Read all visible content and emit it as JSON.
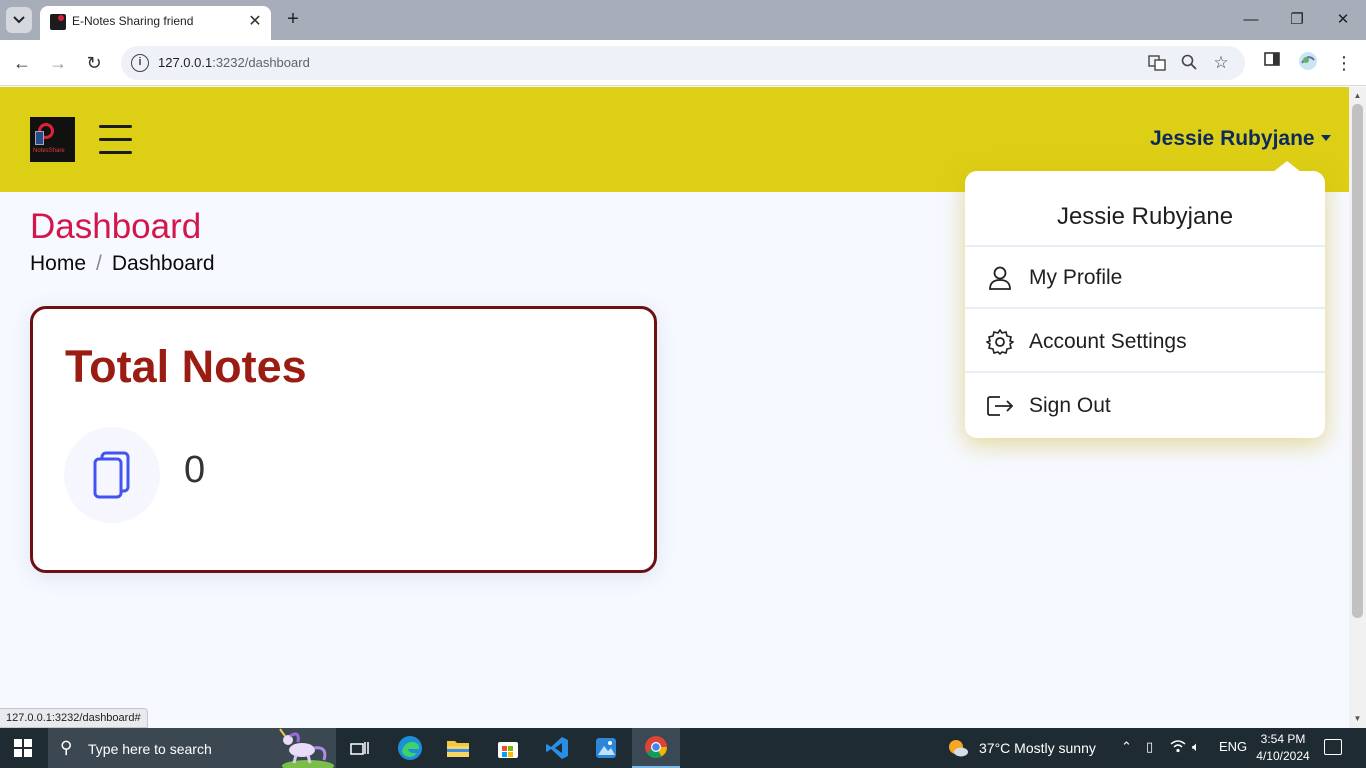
{
  "browser": {
    "tab_title": "E-Notes Sharing friend",
    "url_host": "127.0.0.1",
    "url_path": ":3232/dashboard",
    "status_url": "127.0.0.1:3232/dashboard#"
  },
  "app": {
    "user_name": "Jessie Rubyjane",
    "logo_text": "NotesShare",
    "page_title": "Dashboard",
    "breadcrumb": [
      "Home",
      "Dashboard"
    ]
  },
  "card": {
    "title": "Total Notes",
    "value": "0"
  },
  "dropdown": {
    "header": "Jessie Rubyjane",
    "items": [
      {
        "label": "My Profile",
        "icon": "person-icon"
      },
      {
        "label": "Account Settings",
        "icon": "gear-icon"
      },
      {
        "label": "Sign Out",
        "icon": "sign-out-icon"
      }
    ]
  },
  "taskbar": {
    "search_placeholder": "Type here to search",
    "weather": "37°C  Mostly sunny",
    "language": "ENG",
    "time": "3:54 PM",
    "date": "4/10/2024"
  },
  "colors": {
    "header_bg": "#ddcf15",
    "page_title": "#d4174b",
    "card_border": "#6e0f12",
    "card_title": "#9b1c12",
    "user_name": "#0d2a5c"
  }
}
